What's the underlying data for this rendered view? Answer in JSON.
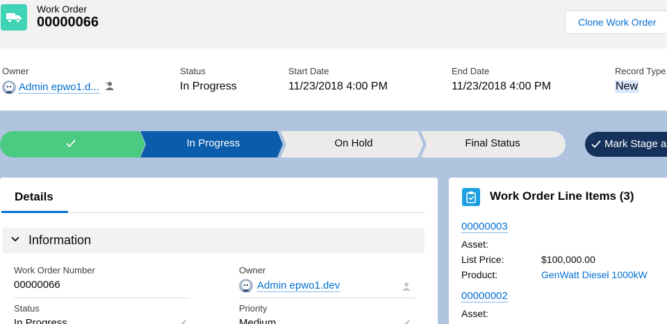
{
  "header": {
    "object_type": "Work Order",
    "record_number": "00000066",
    "clone_button": "Clone Work Order"
  },
  "highlights": {
    "owner": {
      "label": "Owner",
      "value": "Admin epwo1.d..."
    },
    "status": {
      "label": "Status",
      "value": "In Progress"
    },
    "start_date": {
      "label": "Start Date",
      "value": "11/23/2018 4:00 PM"
    },
    "end_date": {
      "label": "End Date",
      "value": "11/23/2018 4:00 PM"
    },
    "record_type": {
      "label": "Record Type",
      "value": "New"
    }
  },
  "path": {
    "stages": [
      {
        "label": "",
        "state": "complete"
      },
      {
        "label": "In Progress",
        "state": "current"
      },
      {
        "label": "On Hold",
        "state": "incomplete"
      },
      {
        "label": "Final Status",
        "state": "incomplete"
      }
    ],
    "mark_button": "Mark Stage as Complete"
  },
  "details": {
    "tab": "Details",
    "section_title": "Information",
    "fields": {
      "work_order_number": {
        "label": "Work Order Number",
        "value": "00000066"
      },
      "owner": {
        "label": "Owner",
        "value": "Admin epwo1.dev"
      },
      "status": {
        "label": "Status",
        "value": "In Progress"
      },
      "priority": {
        "label": "Priority",
        "value": "Medium"
      }
    }
  },
  "line_items": {
    "title": "Work Order Line Items (3)",
    "items": [
      {
        "number": "00000003",
        "asset_label": "Asset:",
        "list_price_label": "List Price:",
        "list_price": "$100,000.00",
        "product_label": "Product:",
        "product": "GenWatt Diesel 1000kW"
      },
      {
        "number": "00000002",
        "asset_label": "Asset:"
      }
    ]
  },
  "colors": {
    "brand_blue": "#0070d2",
    "path_complete": "#4bca81",
    "path_current": "#0b5cab",
    "path_incomplete": "#ecebea",
    "mark_button": "#16325c",
    "work_order_icon": "#3fd4b5",
    "line_item_icon": "#1b9ee2"
  }
}
